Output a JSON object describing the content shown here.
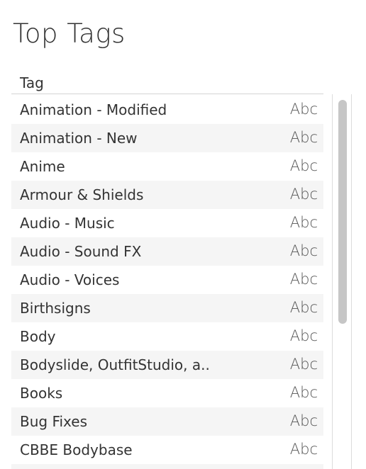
{
  "title": "Top Tags",
  "table": {
    "column_header": "Tag",
    "rows": [
      {
        "tag": "Animation - Modified",
        "type": "Abc"
      },
      {
        "tag": "Animation - New",
        "type": "Abc"
      },
      {
        "tag": "Anime",
        "type": "Abc"
      },
      {
        "tag": "Armour & Shields",
        "type": "Abc"
      },
      {
        "tag": "Audio - Music",
        "type": "Abc"
      },
      {
        "tag": "Audio - Sound FX",
        "type": "Abc"
      },
      {
        "tag": "Audio - Voices",
        "type": "Abc"
      },
      {
        "tag": "Birthsigns",
        "type": "Abc"
      },
      {
        "tag": "Body",
        "type": "Abc"
      },
      {
        "tag": "Bodyslide, OutfitStudio, a..",
        "type": "Abc"
      },
      {
        "tag": "Books",
        "type": "Abc"
      },
      {
        "tag": "Bug Fixes",
        "type": "Abc"
      },
      {
        "tag": "CBBE Bodybase",
        "type": "Abc"
      }
    ]
  }
}
